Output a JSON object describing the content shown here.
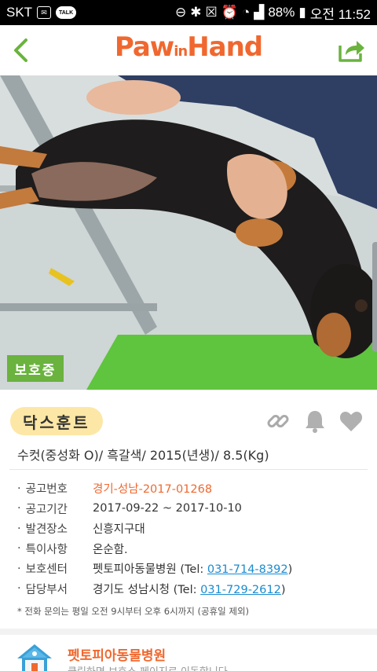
{
  "status_bar": {
    "carrier": "SKT",
    "talk_label": "TALK",
    "battery": "88%",
    "time": "오전 11:52"
  },
  "app": {
    "logo_part1": "Paw",
    "logo_part2": "in",
    "logo_part3": "Hand",
    "accent_color": "#f0682f",
    "green_color": "#6ab33e"
  },
  "photo": {
    "status_label": "보호중"
  },
  "animal": {
    "breed": "닥스훈트",
    "summary": "수컷(중성화 O)/ 흑갈색/ 2015(년생)/ 8.5(Kg)"
  },
  "details": {
    "notice_no_label": "공고번호",
    "notice_no": "경기-성남-2017-01268",
    "period_label": "공고기간",
    "period": "2017-09-22 ~ 2017-10-10",
    "found_label": "발견장소",
    "found": "신흥지구대",
    "feature_label": "특이사항",
    "feature": "온순함.",
    "center_label": "보호센터",
    "center_name": "펫토피아동물병원",
    "center_tel_prefix": "(Tel: ",
    "center_tel": "031-714-8392",
    "tel_suffix": ")",
    "dept_label": "담당부서",
    "dept_name": "경기도 성남시청",
    "dept_tel_prefix": "(Tel: ",
    "dept_tel": "031-729-2612"
  },
  "note": "* 전화 문의는 평일 오전 9시부터 오후 6시까지 (공휴일 제외)",
  "shelter": {
    "name": "펫토피아동물병원",
    "subtitle": "클릭하면 보호소 페이지로 이동합니다"
  }
}
